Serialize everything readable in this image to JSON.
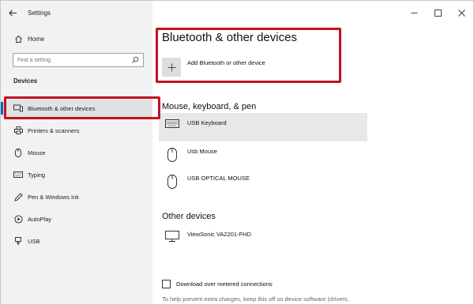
{
  "window": {
    "app_title": "Settings"
  },
  "sidebar": {
    "home_label": "Home",
    "search_placeholder": "Find a setting",
    "section": "Devices",
    "items": [
      {
        "label": "Bluetooth & other devices",
        "icon": "bluetooth-devices-icon",
        "selected": true
      },
      {
        "label": "Printers & scanners",
        "icon": "printer-icon"
      },
      {
        "label": "Mouse",
        "icon": "mouse-icon"
      },
      {
        "label": "Typing",
        "icon": "keyboard-icon"
      },
      {
        "label": "Pen & Windows Ink",
        "icon": "pen-icon"
      },
      {
        "label": "AutoPlay",
        "icon": "autoplay-icon"
      },
      {
        "label": "USB",
        "icon": "usb-icon"
      }
    ]
  },
  "main": {
    "title": "Bluetooth & other devices",
    "add_device_label": "Add Bluetooth or other device",
    "mouse_section": "Mouse, keyboard, & pen",
    "mouse_devices": [
      {
        "name": "USB Keyboard",
        "icon": "keyboard-icon",
        "selected": true
      },
      {
        "name": "Usb Mouse",
        "icon": "mouse-icon"
      },
      {
        "name": "USB OPTICAL MOUSE",
        "icon": "mouse-icon"
      }
    ],
    "other_section": "Other devices",
    "other_devices": [
      {
        "name": "ViewSonic VA2201-FHD",
        "icon": "monitor-icon"
      }
    ],
    "metered_label": "Download over metered connections",
    "metered_help": "To help prevent extra charges, keep this off so device software (drivers,"
  },
  "colors": {
    "accent": "#0067b8",
    "highlight": "#c1121f",
    "sidebar_bg": "#f2f2f2"
  }
}
